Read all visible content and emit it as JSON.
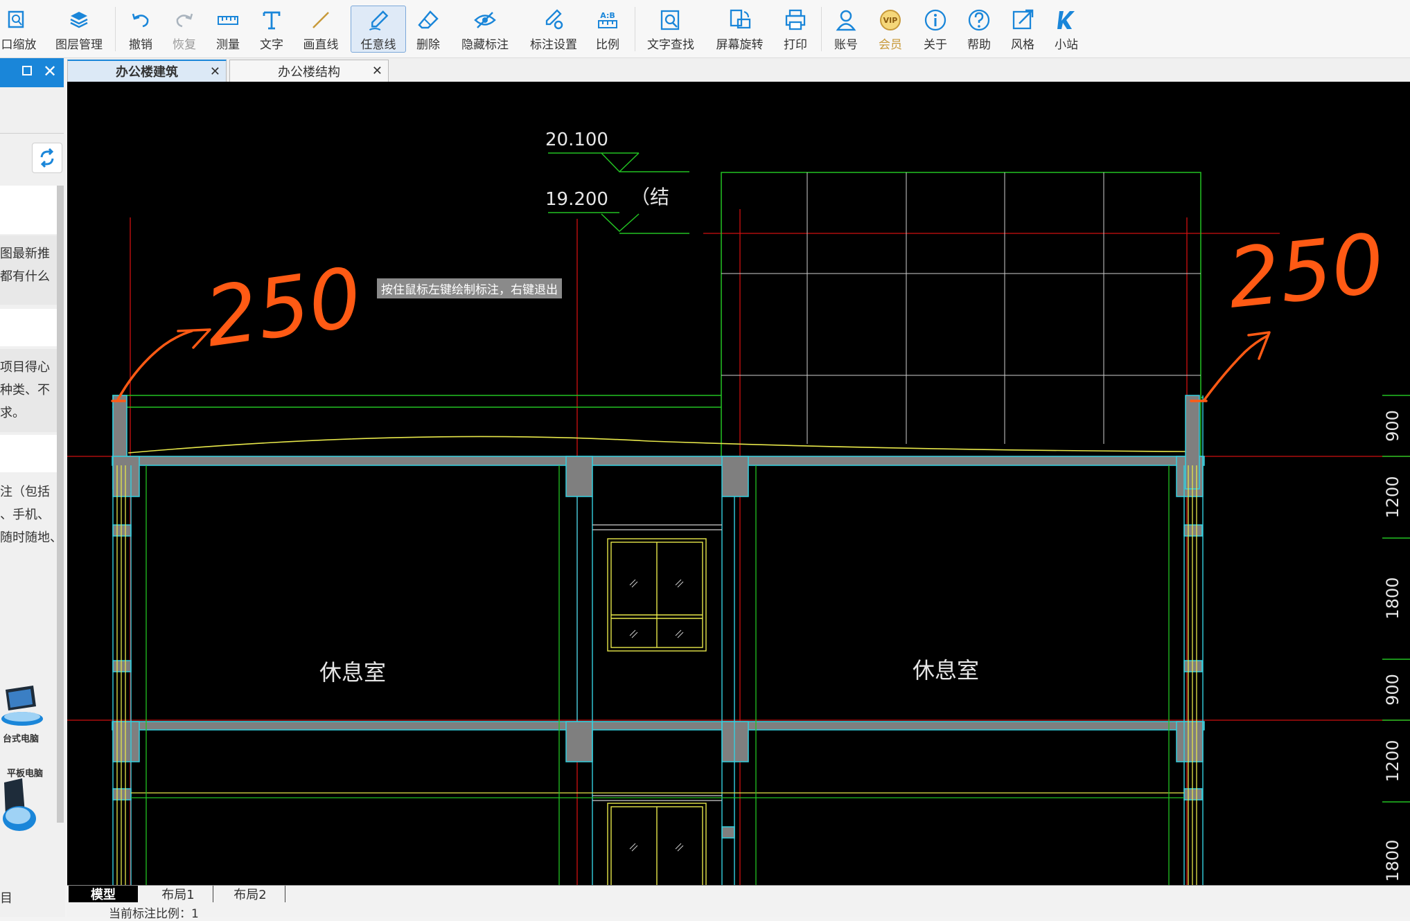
{
  "toolbar": {
    "buttons": [
      {
        "label": "口缩放",
        "icon": "zoom-window-icon"
      },
      {
        "label": "图层管理",
        "icon": "layers-icon"
      },
      {
        "label": "撤销",
        "icon": "undo-icon"
      },
      {
        "label": "恢复",
        "icon": "redo-icon"
      },
      {
        "label": "测量",
        "icon": "measure-ruler-icon"
      },
      {
        "label": "文字",
        "icon": "text-icon"
      },
      {
        "label": "画直线",
        "icon": "line-icon"
      },
      {
        "label": "任意线",
        "icon": "freehand-pen-icon"
      },
      {
        "label": "删除",
        "icon": "eraser-icon"
      },
      {
        "label": "隐藏标注",
        "icon": "hide-eye-icon"
      },
      {
        "label": "标注设置",
        "icon": "annotation-settings-icon"
      },
      {
        "label": "比例",
        "icon": "scale-icon"
      },
      {
        "label": "文字查找",
        "icon": "text-search-icon"
      },
      {
        "label": "屏幕旋转",
        "icon": "rotate-screen-icon"
      },
      {
        "label": "打印",
        "icon": "printer-icon"
      },
      {
        "label": "账号",
        "icon": "user-icon"
      },
      {
        "label": "会员",
        "icon": "vip-badge-icon"
      },
      {
        "label": "关于",
        "icon": "info-icon"
      },
      {
        "label": "帮助",
        "icon": "help-icon"
      },
      {
        "label": "风格",
        "icon": "style-icon"
      },
      {
        "label": "小站",
        "icon": "k-logo-icon"
      }
    ],
    "scale_icon_text": "A:B",
    "vip_icon_text": "VIP"
  },
  "left_panel": {
    "lines": [
      "图最新推",
      "都有什么",
      "项目得心",
      "种类、不",
      "求。",
      "注（包括",
      "、手机、",
      "随时随地、"
    ],
    "desktop_label": "台式电脑",
    "tablet_label": "平板电脑",
    "bottom_text": "目"
  },
  "tabs": [
    {
      "label": "办公楼建筑",
      "active": true
    },
    {
      "label": "办公楼结构",
      "active": false
    }
  ],
  "canvas": {
    "elevation_top": "20.100",
    "elevation_mid": "19.200",
    "struct_note": "（结",
    "room_label_left": "休息室",
    "room_label_right": "休息室",
    "annotation_left": "250",
    "annotation_right": "250",
    "dimensions": [
      "900",
      "1200",
      "1800",
      "900",
      "1200",
      "1800"
    ],
    "hint": "按住鼠标左键绘制标注，右键退出"
  },
  "layout_tabs": [
    {
      "label": "模型",
      "active": true
    },
    {
      "label": "布局1",
      "active": false
    },
    {
      "label": "布局2",
      "active": false
    }
  ],
  "status": {
    "text": "当前标注比例：1"
  },
  "colors": {
    "accent": "#1a86d9",
    "cad_background": "#000000",
    "markup_orange": "#ff5a14",
    "wall_fill": "#7f7f7f",
    "cyan": "#34d0e0",
    "green": "#23c323",
    "yellow": "#e8e84a",
    "red": "#d01010"
  }
}
